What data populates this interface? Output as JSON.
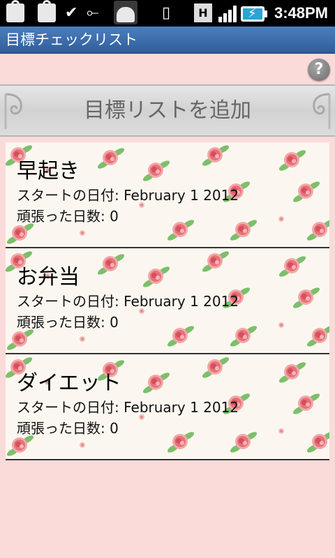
{
  "status_bar": {
    "time": "3:48PM",
    "h_badge": "H",
    "icons": [
      "shopping-bag-icon",
      "shopping-bag-icon",
      "download-complete-icon",
      "usb-icon",
      "android-debug-icon",
      "vibrate-icon",
      "network-h-icon",
      "signal-bars-icon",
      "battery-charging-icon"
    ]
  },
  "app": {
    "title": "目標チェックリスト"
  },
  "help_button": {
    "label": "?"
  },
  "add_button": {
    "label": "目標リストを追加"
  },
  "goals": [
    {
      "title": "早起き",
      "start_label": "スタートの日付: ",
      "start_date": "February 1 2012",
      "days_label": "頑張った日数: ",
      "days": "0"
    },
    {
      "title": "お弁当",
      "start_label": "スタートの日付: ",
      "start_date": "February 1 2012",
      "days_label": "頑張った日数: ",
      "days": "0"
    },
    {
      "title": "ダイエット",
      "start_label": "スタートの日付: ",
      "start_date": "February 1 2012",
      "days_label": "頑張った日数: ",
      "days": "0"
    }
  ],
  "colors": {
    "background": "#fbdada",
    "title_bar": "#3a6aa8",
    "card_background": "#fbf7f0",
    "rose": "#e8707a",
    "leaf": "#7cbf6a"
  }
}
